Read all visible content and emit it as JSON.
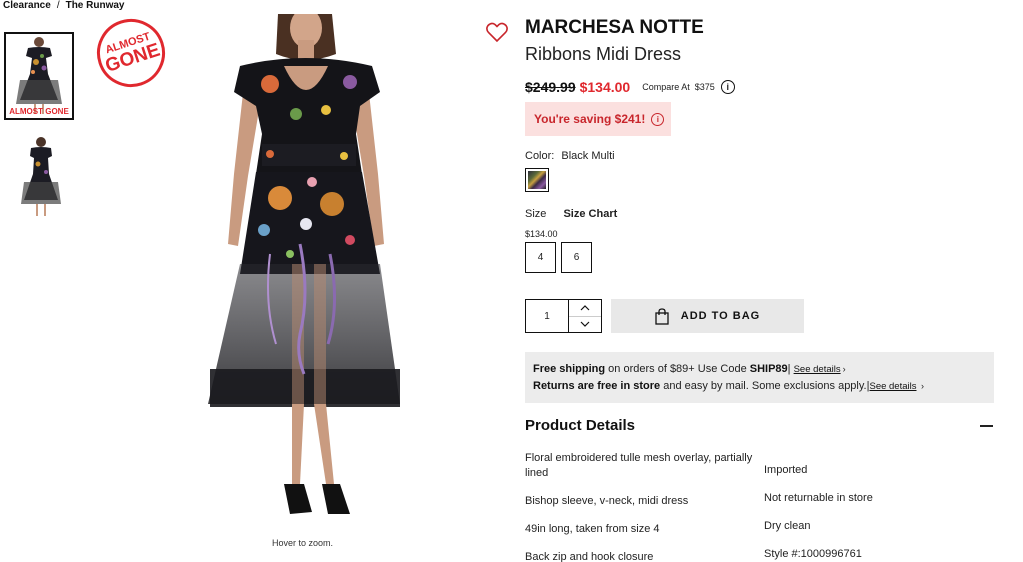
{
  "breadcrumb": {
    "items": [
      "Clearance",
      "The Runway"
    ],
    "separator": "/"
  },
  "badge": {
    "line1": "ALMOST",
    "line2": "GONE",
    "thumb_label": "ALMOST GONE"
  },
  "gallery": {
    "hover_text": "Hover to zoom."
  },
  "product": {
    "brand": "MARCHESA NOTTE",
    "name": "Ribbons Midi Dress",
    "old_price": "$249.99",
    "price": "$134.00",
    "compare_label": "Compare At",
    "compare_value": "$375",
    "saving_text": "You're saving $241!",
    "color_label": "Color:",
    "color_value": "Black Multi",
    "size_label": "Size",
    "size_chart_label": "Size Chart",
    "size_price": "$134.00",
    "sizes": [
      "4",
      "6"
    ],
    "quantity": "1",
    "add_to_bag": "ADD TO BAG"
  },
  "shipping": {
    "free_shipping_bold": "Free shipping",
    "free_shipping_text": " on orders of $89+ Use Code ",
    "code": "SHIP89",
    "see_details": "See details",
    "returns_bold": "Returns are free in store",
    "returns_text": " and easy by mail. Some exclusions apply.",
    "see_details_2": "See details"
  },
  "details": {
    "title": "Product Details",
    "left": [
      "Floral embroidered tulle mesh overlay, partially lined",
      "Bishop sleeve, v-neck, midi dress",
      "49in long, taken from size 4",
      "Back zip and hook closure"
    ],
    "right": [
      "Imported",
      "Not returnable in store",
      "Dry clean",
      "Style #:1000996761"
    ]
  },
  "colors": {
    "accent": "#e0282e",
    "saving_bg": "#fbe0df",
    "button_bg": "#e8e8e8",
    "info_bg": "#ececec"
  }
}
